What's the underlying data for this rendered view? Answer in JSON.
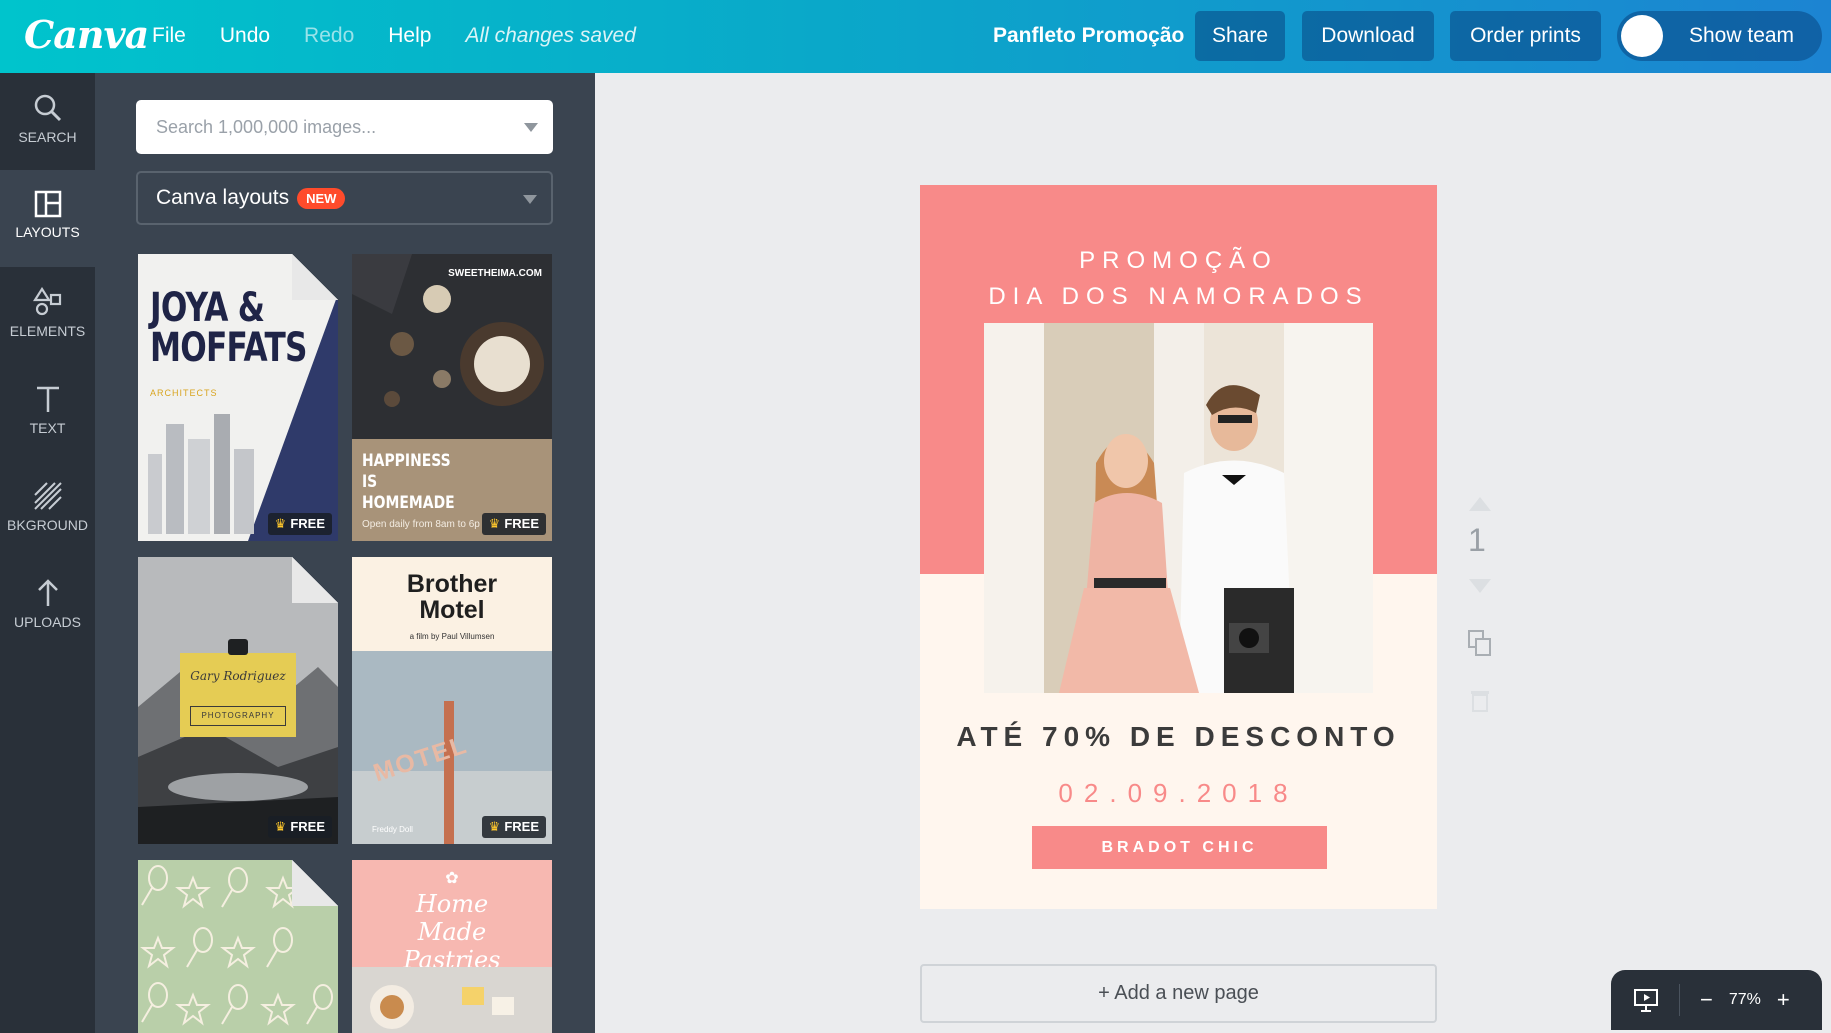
{
  "header": {
    "logo": "Canva",
    "menu": [
      {
        "label": "File",
        "dim": false
      },
      {
        "label": "Undo",
        "dim": false
      },
      {
        "label": "Redo",
        "dim": true
      },
      {
        "label": "Help",
        "dim": false
      }
    ],
    "save_status": "All changes saved",
    "doc_title": "Panfleto Promoção",
    "share_label": "Share",
    "download_label": "Download",
    "order_label": "Order prints",
    "team_label": "Show team"
  },
  "rail": [
    {
      "label": "SEARCH",
      "icon": "search-icon"
    },
    {
      "label": "LAYOUTS",
      "icon": "layout-icon"
    },
    {
      "label": "ELEMENTS",
      "icon": "shapes-icon"
    },
    {
      "label": "TEXT",
      "icon": "text-icon"
    },
    {
      "label": "BKGROUND",
      "icon": "background-icon"
    },
    {
      "label": "UPLOADS",
      "icon": "upload-icon"
    }
  ],
  "panel": {
    "search_placeholder": "Search 1,000,000 images...",
    "layout_select": "Canva layouts",
    "new_badge": "NEW",
    "free_label": "FREE",
    "templates": [
      {
        "title": "JOYA & MOFFATS",
        "subtitle": "ARCHITECTS"
      },
      {
        "title": "HAPPINESS IS HOMEMADE",
        "caption": "Open daily from 8am to 6p",
        "site": "SWEETHEIMA.COM"
      },
      {
        "title": "Gary Rodriguez",
        "subtitle": "PHOTOGRAPHY"
      },
      {
        "title": "Brother Motel",
        "subtitle": "a film by Paul Villumsen",
        "sign": "MOTEL",
        "credit": "Freddy Doll"
      },
      {
        "title": "",
        "subtitle": ""
      },
      {
        "title": "Home Made Pastries",
        "subtitle": ""
      }
    ]
  },
  "flyer": {
    "title_line1": "PROMOÇÃO",
    "title_line2": "DIA DOS NAMORADOS",
    "discount": "ATÉ 70% DE DESCONTO",
    "date": "02.09.2018",
    "brand": "BRADOT CHIC"
  },
  "page_number": "1",
  "add_page_label": "+ Add a new page",
  "zoom": "77%",
  "colors": {
    "accent": "#00c4cc",
    "flyer_pink": "#f88a89",
    "flyer_cream": "#fff6ee"
  }
}
